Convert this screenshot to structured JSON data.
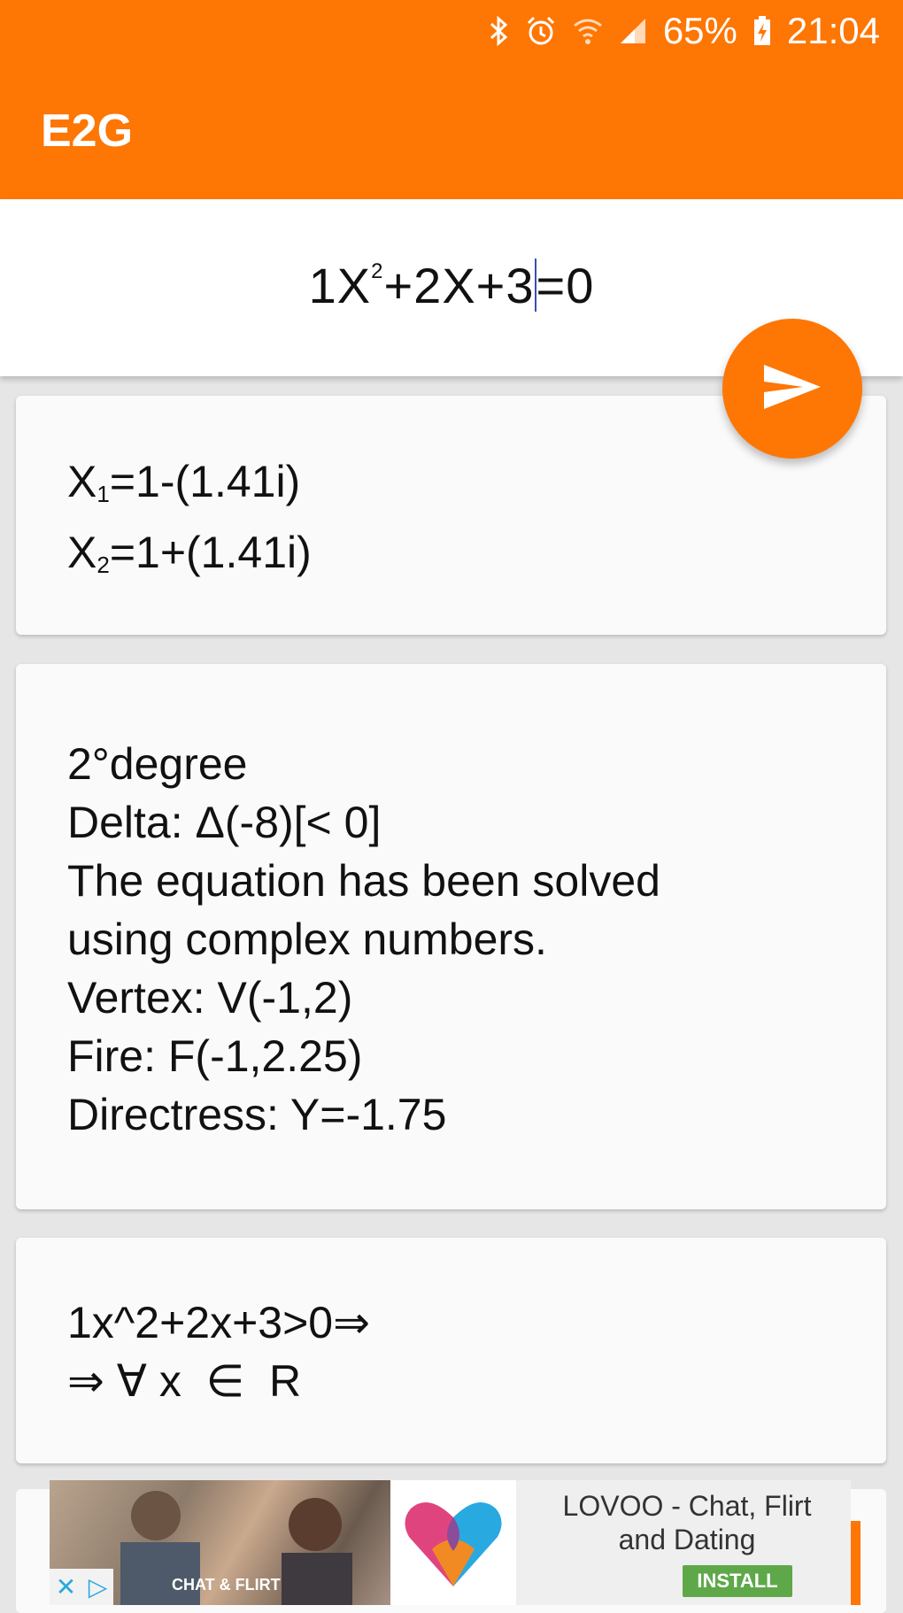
{
  "status_bar": {
    "battery": "65%",
    "time": "21:04",
    "icons": [
      "bluetooth-icon",
      "alarm-icon",
      "wifi-icon",
      "signal-icon",
      "battery-charging-icon"
    ]
  },
  "app": {
    "title": "E2G",
    "accent_color": "#fe7603"
  },
  "input": {
    "coef_a": "1X",
    "exp": "2",
    "rest_before_cursor": "+2X+3",
    "rest_after_cursor": "=0"
  },
  "fab": {
    "icon": "send-icon"
  },
  "roots": {
    "x1_label": "X",
    "x1_sub": "1",
    "x1_value": "=1-(1.41i)",
    "x2_label": "X",
    "x2_sub": "2",
    "x2_value": "=1+(1.41i)"
  },
  "details": {
    "lines": [
      "2°degree",
      "Delta: Δ(-8)[< 0]",
      "The equation has been solved",
      "using complex numbers.",
      "Vertex: V(-1,2)",
      "Fire: F(-1,2.25)",
      "Directress: Y=-1.75"
    ]
  },
  "inequality": {
    "lines": [
      "1x^2+2x+3>0⇒",
      "⇒ ∀ x  ∈  R"
    ]
  },
  "ad": {
    "photo_label": "CHAT & FLIRT",
    "title_line1": "LOVOO - Chat, Flirt",
    "title_line2": "and Dating",
    "install": "INSTALL"
  }
}
